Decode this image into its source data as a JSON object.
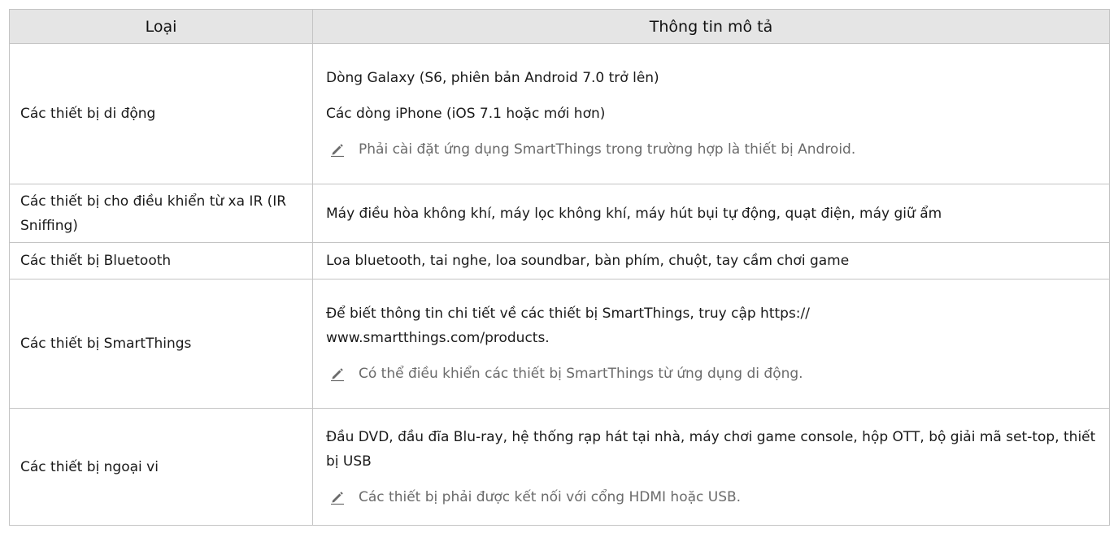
{
  "table": {
    "headers": [
      "Loại",
      "Thông tin mô tả"
    ],
    "rows": [
      {
        "type": "Các thiết bị di động",
        "lines": [
          "Dòng Galaxy (S6, phiên bản Android 7.0 trở lên)",
          "Các dòng iPhone (iOS 7.1 hoặc mới hơn)"
        ],
        "note": "Phải cài đặt ứng dụng SmartThings trong trường hợp là thiết bị Android."
      },
      {
        "type": "Các thiết bị cho điều khiển từ xa IR (IR Sniffing)",
        "lines": [
          "Máy điều hòa không khí, máy lọc không khí, máy hút bụi tự động, quạt điện, máy giữ ẩm"
        ]
      },
      {
        "type": "Các thiết bị Bluetooth",
        "lines": [
          "Loa bluetooth, tai nghe, loa soundbar, bàn phím, chuột, tay cầm chơi game"
        ]
      },
      {
        "type": "Các thiết bị SmartThings",
        "lines": [
          "Để biết thông tin chi tiết về các thiết bị SmartThings, truy cập https:// www.smartthings.com/products."
        ],
        "note": "Có thể điều khiển các thiết bị SmartThings từ ứng dụng di động."
      },
      {
        "type": "Các thiết bị ngoại vi",
        "lines": [
          "Đầu DVD, đầu đĩa Blu-ray, hệ thống rạp hát tại nhà, máy chơi game console, hộp OTT, bộ giải mã set-top, thiết bị USB"
        ],
        "note": "Các thiết bị phải được kết nối với cổng HDMI hoặc USB."
      }
    ]
  },
  "icons": {
    "note": "pencil-note-icon"
  },
  "colors": {
    "header_bg": "#e5e5e5",
    "border": "#c4c4c4",
    "note_text": "#6b6b6b"
  }
}
